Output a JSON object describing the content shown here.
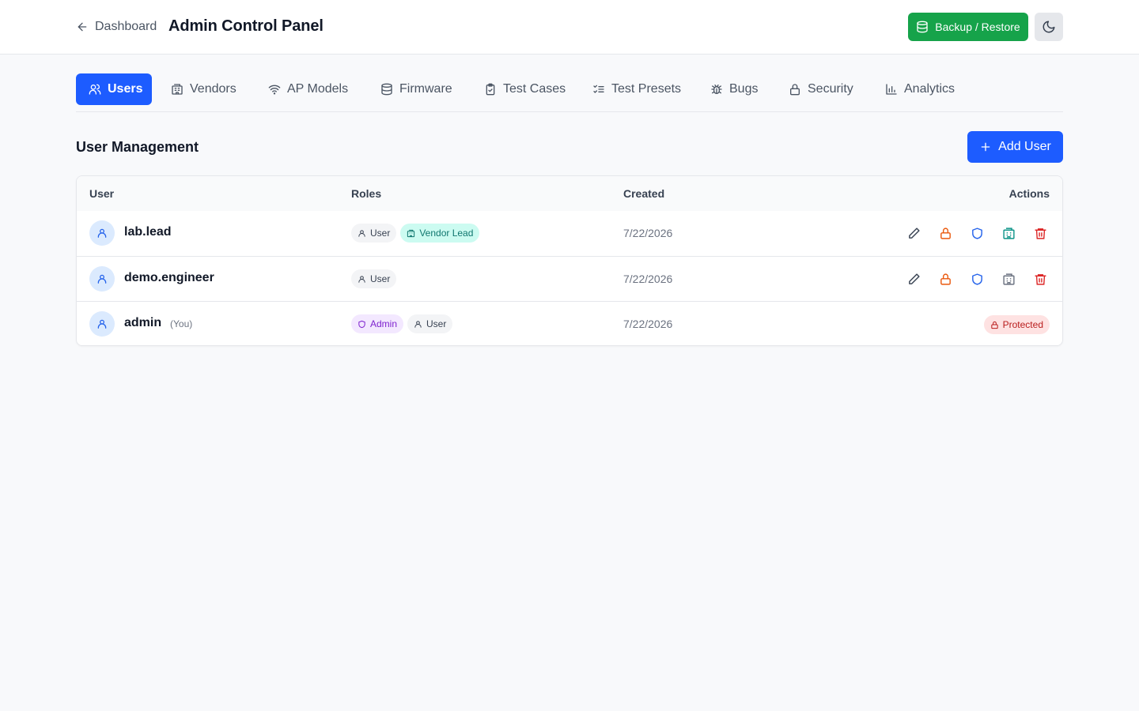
{
  "header": {
    "back_label": "Dashboard",
    "title": "Admin Control Panel",
    "backup_label": "Backup / Restore",
    "theme_icon": "moon-icon"
  },
  "tabs": [
    {
      "label": "Users",
      "icon": "users-icon",
      "active": true
    },
    {
      "label": "Vendors",
      "icon": "building-icon",
      "active": false
    },
    {
      "label": "AP Models",
      "icon": "wifi-icon",
      "active": false
    },
    {
      "label": "Firmware",
      "icon": "database-icon",
      "active": false
    },
    {
      "label": "Test Cases",
      "icon": "clipboard-check-icon",
      "active": false
    },
    {
      "label": "Test Presets",
      "icon": "list-checks-icon",
      "active": false
    },
    {
      "label": "Bugs",
      "icon": "bug-icon",
      "active": false
    },
    {
      "label": "Security",
      "icon": "lock-icon",
      "active": false
    },
    {
      "label": "Analytics",
      "icon": "bar-chart-icon",
      "active": false
    }
  ],
  "section": {
    "title": "User Management",
    "add_label": "Add User"
  },
  "table": {
    "columns": [
      "User",
      "Roles",
      "Created",
      "Actions"
    ],
    "rows": [
      {
        "username": "lab.lead",
        "you": "",
        "roles": [
          {
            "label": "User",
            "kind": "user"
          },
          {
            "label": "Vendor Lead",
            "kind": "vendor"
          }
        ],
        "created": "7/22/2026",
        "vendor_action_color": "#0d9488"
      },
      {
        "username": "demo.engineer",
        "you": "",
        "roles": [
          {
            "label": "User",
            "kind": "user"
          }
        ],
        "created": "7/22/2026",
        "vendor_action_color": "#6b7280"
      },
      {
        "username": "admin",
        "you": "(You)",
        "roles": [
          {
            "label": "Admin",
            "kind": "admin"
          },
          {
            "label": "User",
            "kind": "user"
          }
        ],
        "created": "7/22/2026",
        "protected_label": "Protected"
      }
    ]
  },
  "colors": {
    "primary": "#1d5cff",
    "success": "#16a34a",
    "danger": "#dc2626",
    "warning": "#ea580c",
    "info": "#2563eb"
  }
}
